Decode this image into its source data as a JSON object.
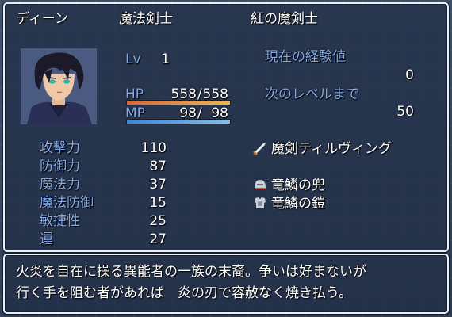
{
  "actor": {
    "name": "ディーン",
    "class": "魔法剣士",
    "nickname": "紅の魔剣士"
  },
  "level": {
    "label": "Lv",
    "value": "1"
  },
  "hp": {
    "label": "HP",
    "current": "558",
    "max": "558",
    "fraction": 1.0
  },
  "mp": {
    "label": "MP",
    "current": "98",
    "max": "98",
    "fraction": 1.0
  },
  "exp": {
    "current_label": "現在の経験値",
    "current_value": "0",
    "next_label": "次のレベルまで",
    "next_value": "50"
  },
  "params": [
    {
      "label": "攻撃力",
      "value": "110"
    },
    {
      "label": "防御力",
      "value": "87"
    },
    {
      "label": "魔法力",
      "value": "37"
    },
    {
      "label": "魔法防御",
      "value": "15"
    },
    {
      "label": "敏捷性",
      "value": "25"
    },
    {
      "label": "運",
      "value": "27"
    }
  ],
  "equipment": [
    {
      "icon": "sword-icon",
      "name": "魔剣ティルヴィング"
    },
    {
      "icon": "helmet-icon",
      "name": "竜鱗の兜"
    },
    {
      "icon": "armor-icon",
      "name": "竜鱗の鎧"
    }
  ],
  "profile": {
    "line1": "火炎を自在に操る異能者の一族の末裔。争いは好まないが",
    "line2": "行く手を阻む者があれば　炎の刃で容赦なく焼き払う。"
  },
  "colors": {
    "system_text": "#84a9e6",
    "normal_text": "#ffffff",
    "hp_gauge": "#e88a3e",
    "mp_gauge": "#4f9be0",
    "window_border": "#e9eef6"
  }
}
